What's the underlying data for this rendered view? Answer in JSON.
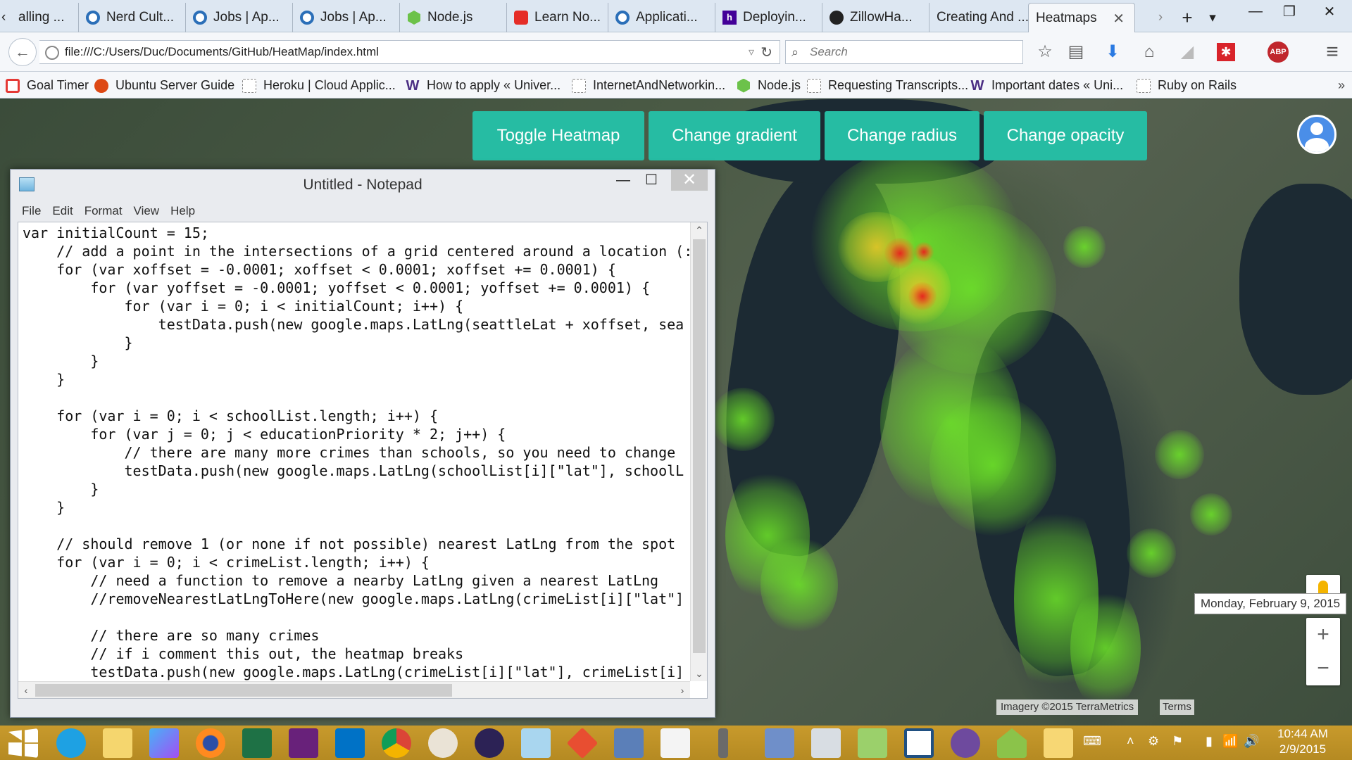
{
  "tabs": [
    {
      "label": "alling ...",
      "icon": "page-icon"
    },
    {
      "label": "Nerd Cult...",
      "icon": "ring-icon"
    },
    {
      "label": "Jobs | Ap...",
      "icon": "ring-icon"
    },
    {
      "label": "Jobs | Ap...",
      "icon": "ring-icon"
    },
    {
      "label": "Node.js",
      "icon": "nodejs-icon"
    },
    {
      "label": "Learn No...",
      "icon": "youtube-icon"
    },
    {
      "label": "Applicati...",
      "icon": "ring-icon"
    },
    {
      "label": "Deployin...",
      "icon": "heroku-icon"
    },
    {
      "label": "ZillowHa...",
      "icon": "github-icon"
    },
    {
      "label": "Creating And ...",
      "icon": "none"
    },
    {
      "label": "Heatmaps",
      "icon": "none",
      "active": true
    }
  ],
  "tab_controls": {
    "scroll_left": "‹",
    "scroll_right": "›",
    "new_tab": "+",
    "list": "▾",
    "close_active": "✕"
  },
  "window_controls": {
    "minimize": "—",
    "maximize": "❐",
    "close": "✕"
  },
  "navbar": {
    "back": "←",
    "url": "file:///C:/Users/Duc/Documents/GitHub/HeatMap/index.html",
    "reload": "↻",
    "dropdown": "▿",
    "search_placeholder": "Search",
    "search_glyph": "⌕",
    "star": "☆",
    "bookmarks_list": "▤",
    "downloads": "⬇",
    "home": "⌂",
    "share": "◢",
    "addon_red": "✱",
    "abp": "ABP",
    "menu": "≡"
  },
  "bookmarks": [
    {
      "label": "Goal Timer",
      "icon": "goal-timer-icon"
    },
    {
      "label": "Ubuntu Server Guide",
      "icon": "ubuntu-icon"
    },
    {
      "label": "Heroku | Cloud Applic...",
      "icon": "page-icon"
    },
    {
      "label": "How to apply « Univer...",
      "icon": "uw-icon"
    },
    {
      "label": "InternetAndNetworkin...",
      "icon": "page-icon"
    },
    {
      "label": "Node.js",
      "icon": "nodejs-icon"
    },
    {
      "label": "Requesting Transcripts...",
      "icon": "page-icon"
    },
    {
      "label": "Important dates « Uni...",
      "icon": "uw-icon"
    },
    {
      "label": "Ruby on Rails",
      "icon": "page-icon"
    }
  ],
  "bookmarks_overflow": "»",
  "map": {
    "buttons": [
      "Toggle Heatmap",
      "Change gradient",
      "Change radius",
      "Change opacity"
    ],
    "button_color": "#26bca3",
    "attribution": "Imagery ©2015 TerraMetrics",
    "terms": "Terms",
    "zoom_in": "+",
    "zoom_out": "−"
  },
  "notepad": {
    "title": "Untitled - Notepad",
    "menu": [
      "File",
      "Edit",
      "Format",
      "View",
      "Help"
    ],
    "controls": {
      "minimize": "—",
      "maximize": "☐",
      "close": "✕"
    },
    "scroll": {
      "up": "⌃",
      "down": "⌄",
      "left": "‹",
      "right": "›"
    },
    "text": "var initialCount = 15;\n    // add a point in the intersections of a grid centered around a location (:\n    for (var xoffset = -0.0001; xoffset < 0.0001; xoffset += 0.0001) {\n        for (var yoffset = -0.0001; yoffset < 0.0001; yoffset += 0.0001) {\n            for (var i = 0; i < initialCount; i++) {\n                testData.push(new google.maps.LatLng(seattleLat + xoffset, sea\n            }\n        }\n    }\n\n    for (var i = 0; i < schoolList.length; i++) {\n        for (var j = 0; j < educationPriority * 2; j++) {\n            // there are many more crimes than schools, so you need to change \n            testData.push(new google.maps.LatLng(schoolList[i][\"lat\"], schoolL\n        }\n    }\n\n    // should remove 1 (or none if not possible) nearest LatLng from the spot\n    for (var i = 0; i < crimeList.length; i++) {\n        // need a function to remove a nearby LatLng given a nearest LatLng\n        //removeNearestLatLngToHere(new google.maps.LatLng(crimeList[i][\"lat\"]\n\n        // there are so many crimes\n        // if i comment this out, the heatmap breaks\n        testData.push(new google.maps.LatLng(crimeList[i][\"lat\"], crimeList[i]"
  },
  "taskbar": {
    "icons": [
      "start-icon",
      "ie-icon",
      "file-explorer-icon",
      "jetbrains-icon",
      "firefox-icon",
      "excel-icon",
      "visual-studio-icon",
      "mail-icon",
      "chrome-icon",
      "paint-icon",
      "eclipse-icon",
      "notepad-icon",
      "git-icon",
      "virtualbox-icon",
      "document-icon",
      "microphone-icon",
      "star-icon",
      "monitor-icon",
      "notepadpp-icon",
      "sourcetree-icon",
      "github-icon",
      "android-icon",
      "folder-icon"
    ],
    "tray_glyphs": [
      "⌨",
      "˄",
      "⚙",
      "⚑",
      "▮",
      "📶",
      "🔊"
    ],
    "time": "10:44 AM",
    "date": "2/9/2015",
    "date_tooltip": "Monday, February 9, 2015"
  }
}
